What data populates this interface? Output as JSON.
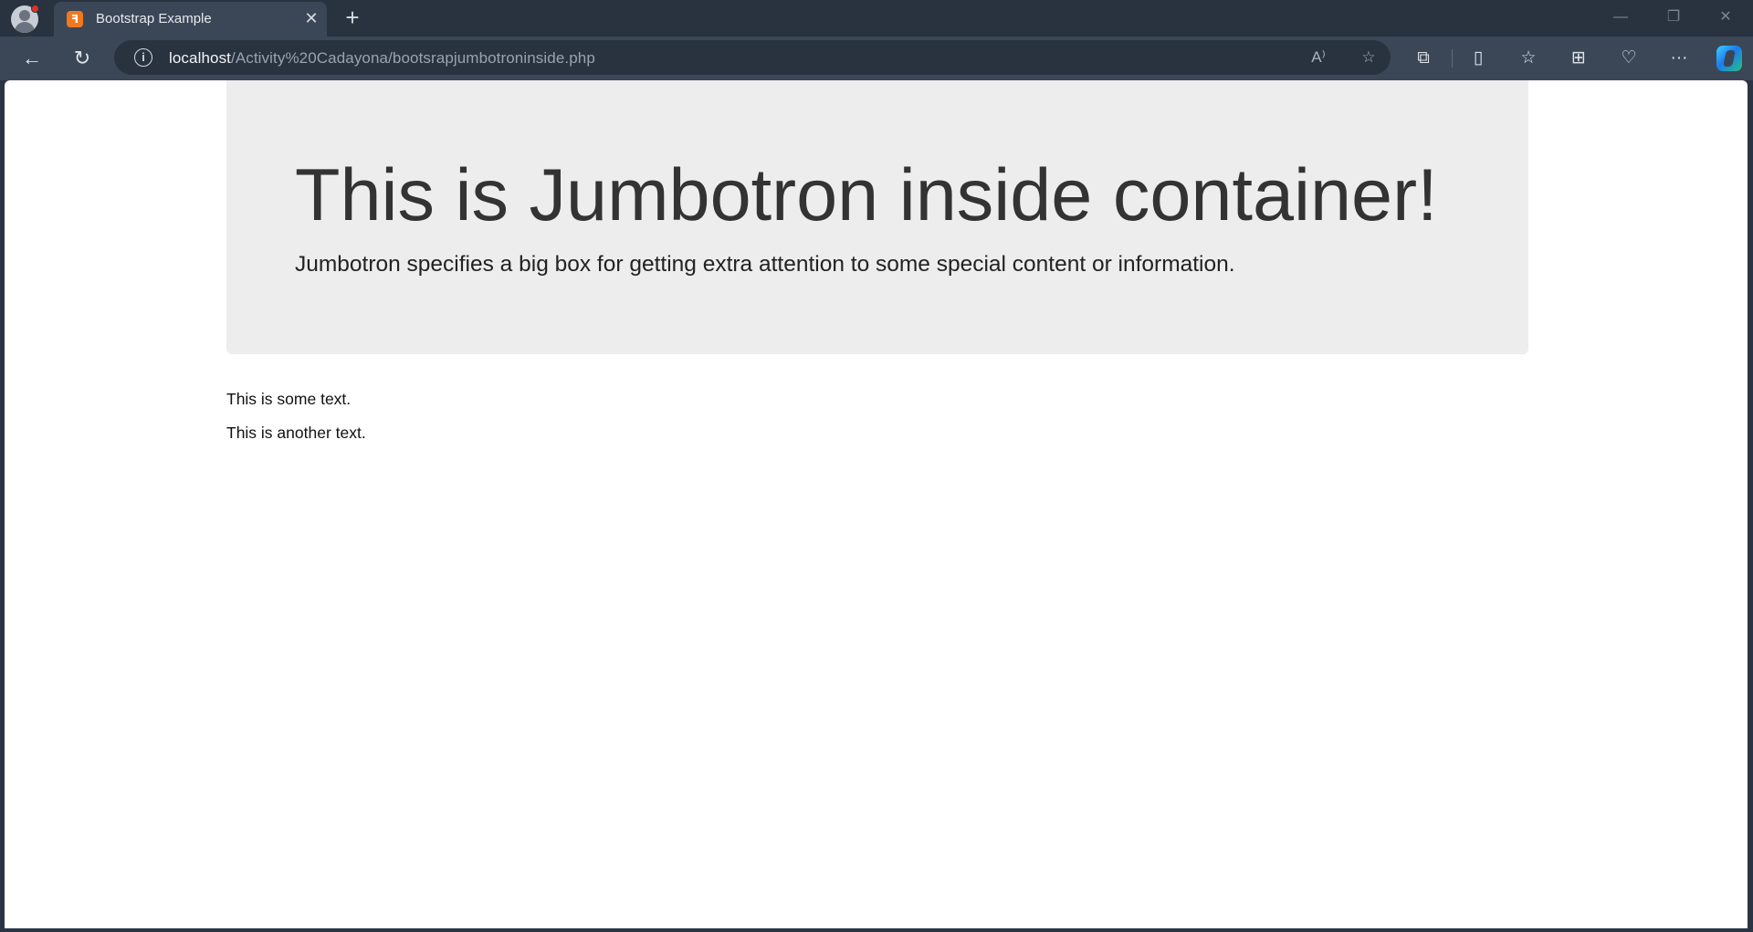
{
  "browser": {
    "tab": {
      "favicon_icon": "xampp-icon",
      "favicon_glyph": "ꟻ",
      "title": "Bootstrap Example",
      "close_glyph": "✕"
    },
    "new_tab_glyph": "+",
    "window_controls": {
      "minimize": "—",
      "restore": "❐",
      "close": "✕"
    },
    "nav": {
      "back_glyph": "←",
      "refresh_glyph": "↻"
    },
    "address": {
      "info_glyph": "i",
      "host": "localhost",
      "path": "/Activity%20Cadayona/bootsrapjumbotroninside.php",
      "read_aloud_glyph": "A⁾",
      "favorite_glyph": "☆"
    },
    "toolbar": {
      "extensions_glyph": "⧉",
      "split_screen_glyph": "▯",
      "favorites_glyph": "☆",
      "collections_glyph": "⊞",
      "health_glyph": "♡",
      "more_glyph": "···"
    }
  },
  "page": {
    "jumbotron": {
      "title": "This is Jumbotron inside container!",
      "lead": "Jumbotron specifies a big box for getting extra attention to some special content or information."
    },
    "paragraphs": [
      "This is some text.",
      "This is another text."
    ]
  },
  "colors": {
    "jumbotron_bg": "#ededed",
    "browser_frame": "#293340",
    "toolbar": "#3b4757",
    "favicon": "#f0791f"
  }
}
